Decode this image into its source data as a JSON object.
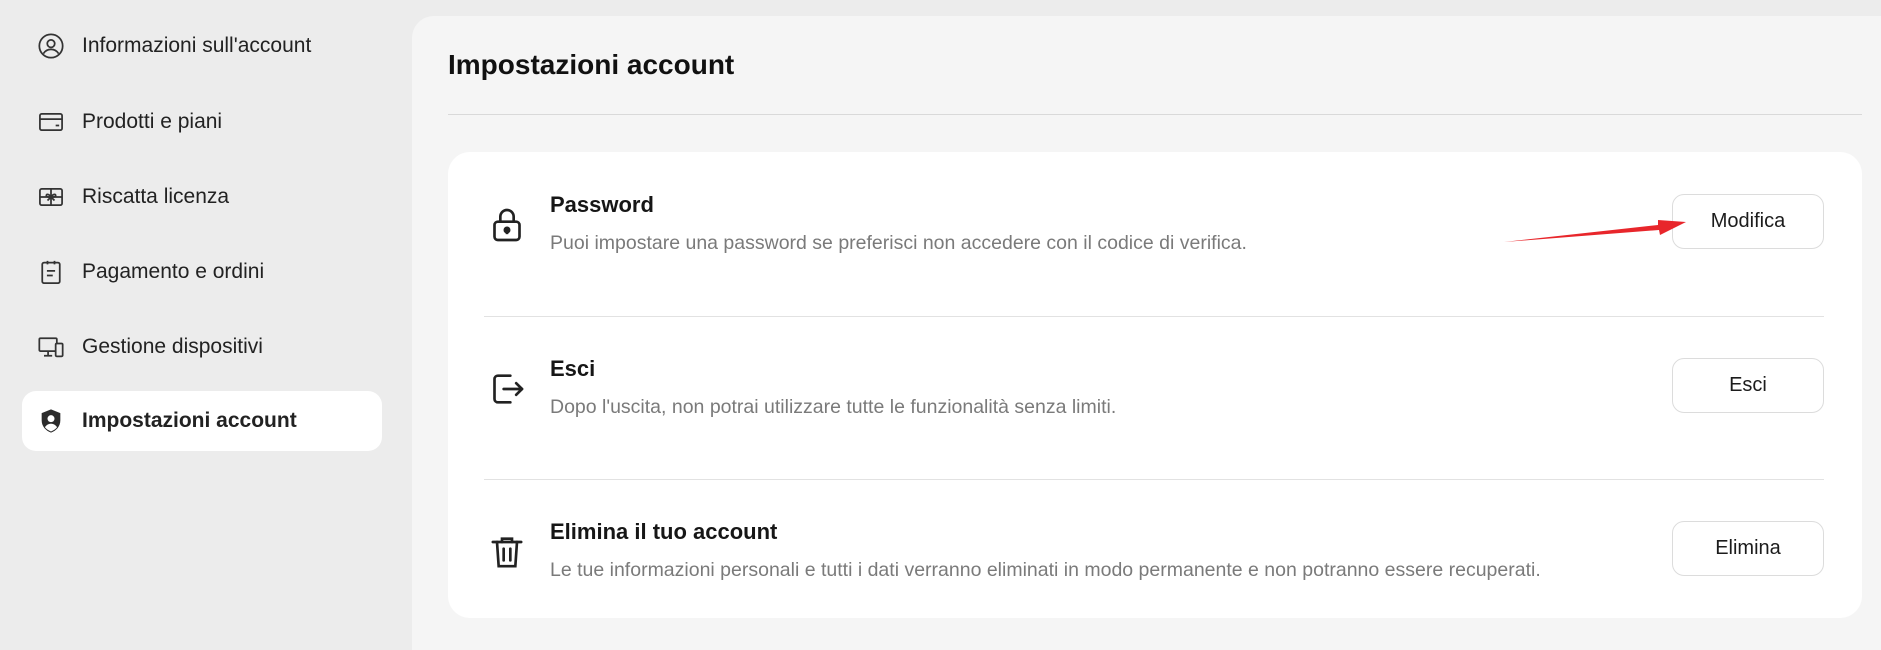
{
  "sidebar": {
    "items": [
      {
        "label": "Informazioni sull'account",
        "icon": "user-circle-icon",
        "active": false
      },
      {
        "label": "Prodotti e piani",
        "icon": "card-icon",
        "active": false
      },
      {
        "label": "Riscatta licenza",
        "icon": "gift-icon",
        "active": false
      },
      {
        "label": "Pagamento e ordini",
        "icon": "clipboard-icon",
        "active": false
      },
      {
        "label": "Gestione dispositivi",
        "icon": "devices-icon",
        "active": false
      },
      {
        "label": "Impostazioni account",
        "icon": "user-shield-icon",
        "active": true
      }
    ]
  },
  "main": {
    "title": "Impostazioni account",
    "rows": [
      {
        "title": "Password",
        "description": "Puoi impostare una password se preferisci non accedere con il codice di verifica.",
        "button": "Modifica",
        "icon": "lock-icon"
      },
      {
        "title": "Esci",
        "description": "Dopo l'uscita, non potrai utilizzare tutte le funzionalità senza limiti.",
        "button": "Esci",
        "icon": "logout-icon"
      },
      {
        "title": "Elimina il tuo account",
        "description": "Le tue informazioni personali e tutti i dati verranno eliminati in modo permanente e non potranno essere recuperati.",
        "button": "Elimina",
        "icon": "trash-icon"
      }
    ]
  },
  "annotation": {
    "color": "#e8262b",
    "icon": "red-arrow-annotation"
  }
}
